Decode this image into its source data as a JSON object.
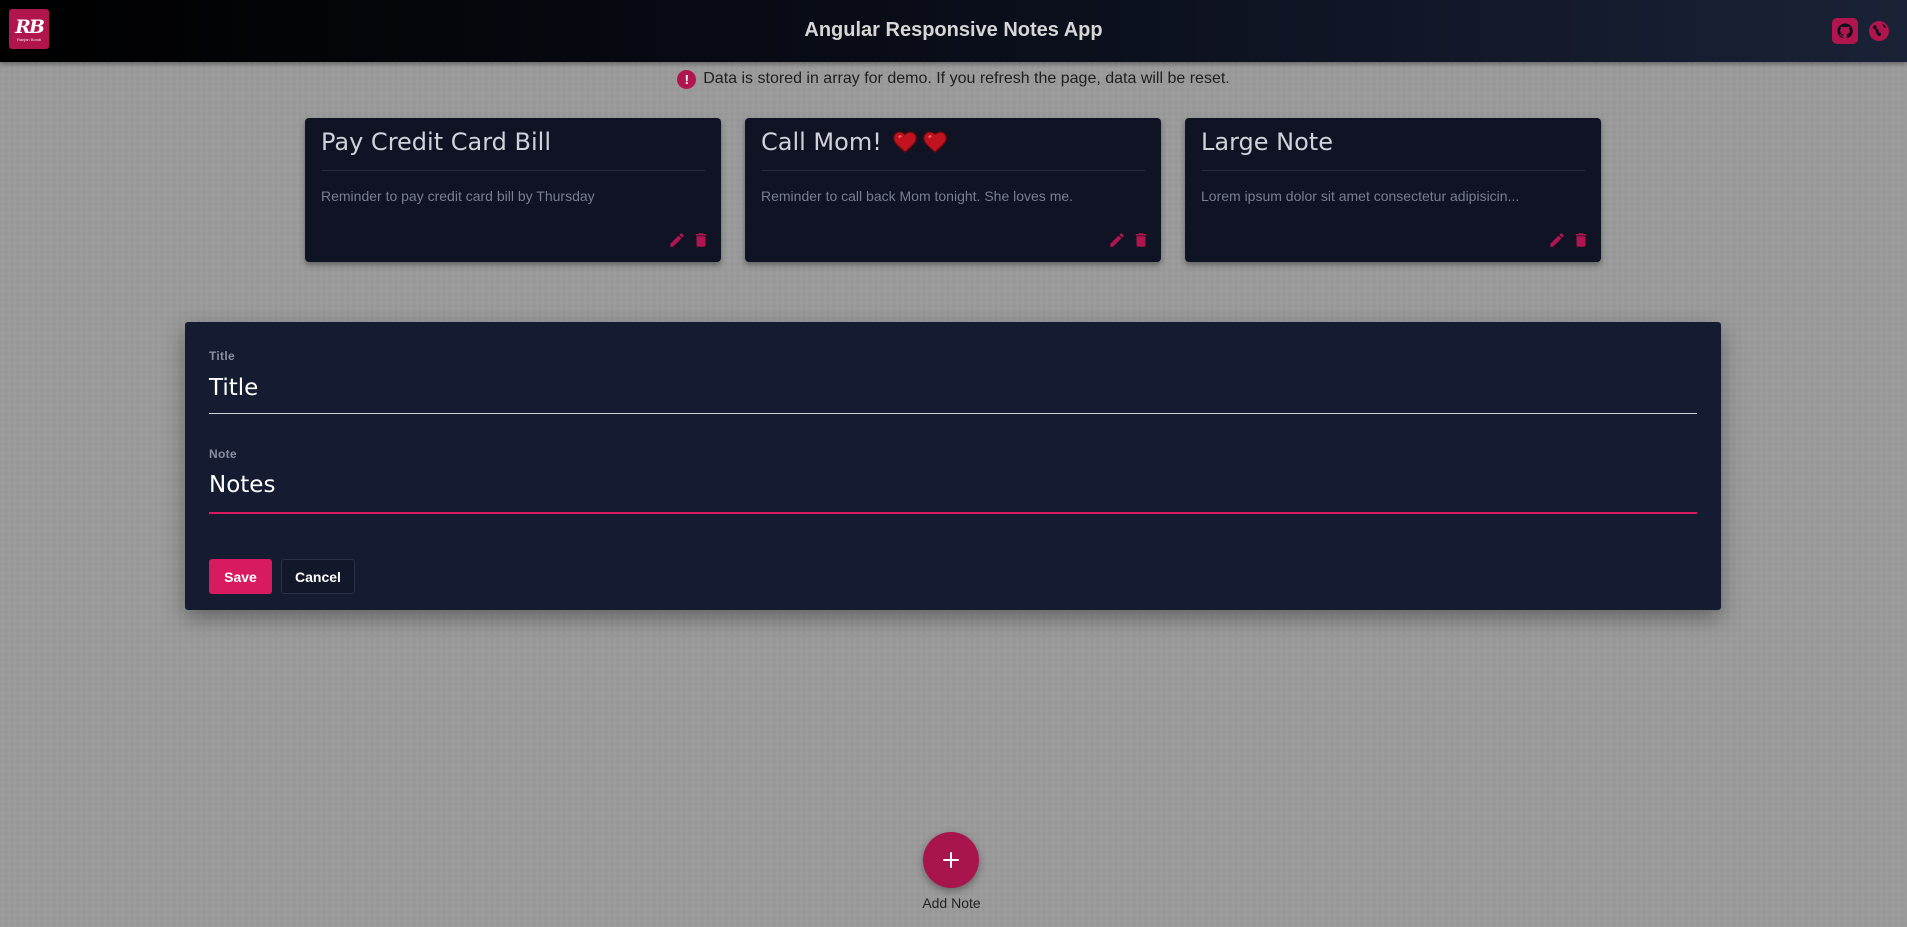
{
  "header": {
    "app_title": "Angular Responsive Notes App",
    "logo_text": "RB",
    "logo_sub": "Ranjan Bondi",
    "github_icon": "github-icon",
    "globe_icon": "globe-icon",
    "accent": "#b0154e"
  },
  "notice": {
    "icon": "alert-circle-icon",
    "text": "Data is stored in array for demo. If you refresh the page, data will be reset."
  },
  "notes": [
    {
      "title": "Pay Credit Card Bill",
      "body": "Reminder to pay credit card bill by Thursday",
      "hearts": 0
    },
    {
      "title": "Call Mom!",
      "body": "Reminder to call back Mom tonight. She loves me.",
      "hearts": 2
    },
    {
      "title": "Large Note",
      "body": "Lorem ipsum dolor sit amet consectetur adipisicin...",
      "hearts": 0
    }
  ],
  "editor": {
    "title_label": "Title",
    "title_value": "Title",
    "note_label": "Note",
    "note_value": "Notes",
    "save_label": "Save",
    "cancel_label": "Cancel"
  },
  "fab": {
    "icon": "plus-icon",
    "label": "Add Note"
  },
  "colors": {
    "header_bg": "#0b0f1c",
    "card_bg": "#0f1324",
    "editor_bg": "#151c31",
    "save_bg": "#d81b60",
    "fab_bg": "#a8154d"
  }
}
